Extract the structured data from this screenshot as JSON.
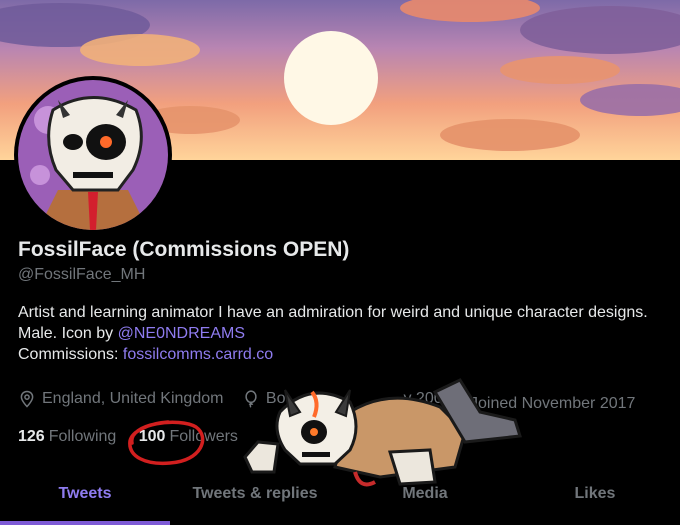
{
  "profile": {
    "display_name": "FossilFace (Commissions OPEN)",
    "handle": "@FossilFace_MH",
    "bio_text": "Artist and learning animator I have an admiration for weird and unique character designs. Male. Icon by ",
    "bio_mention": "@NE0NDREAMS",
    "commissions_label": "Commissions: ",
    "commissions_link": "fossilcomms.carrd.co",
    "location": "England, United Kingdom",
    "birthday": "Bo",
    "birthday_tail": "y 2002",
    "joined": "Joined November 2017"
  },
  "counts": {
    "following_num": "126",
    "following_label": "Following",
    "followers_num": "100",
    "followers_label": "Followers"
  },
  "tabs": [
    {
      "label": "Tweets",
      "active": true
    },
    {
      "label": "Tweets & replies",
      "active": false
    },
    {
      "label": "Media",
      "active": false
    },
    {
      "label": "Likes",
      "active": false
    }
  ],
  "colors": {
    "accent": "#8f7cf0",
    "annotation_red": "#d21f1f"
  },
  "icons": {
    "location": "location-pin-icon",
    "birthday": "balloon-icon"
  }
}
